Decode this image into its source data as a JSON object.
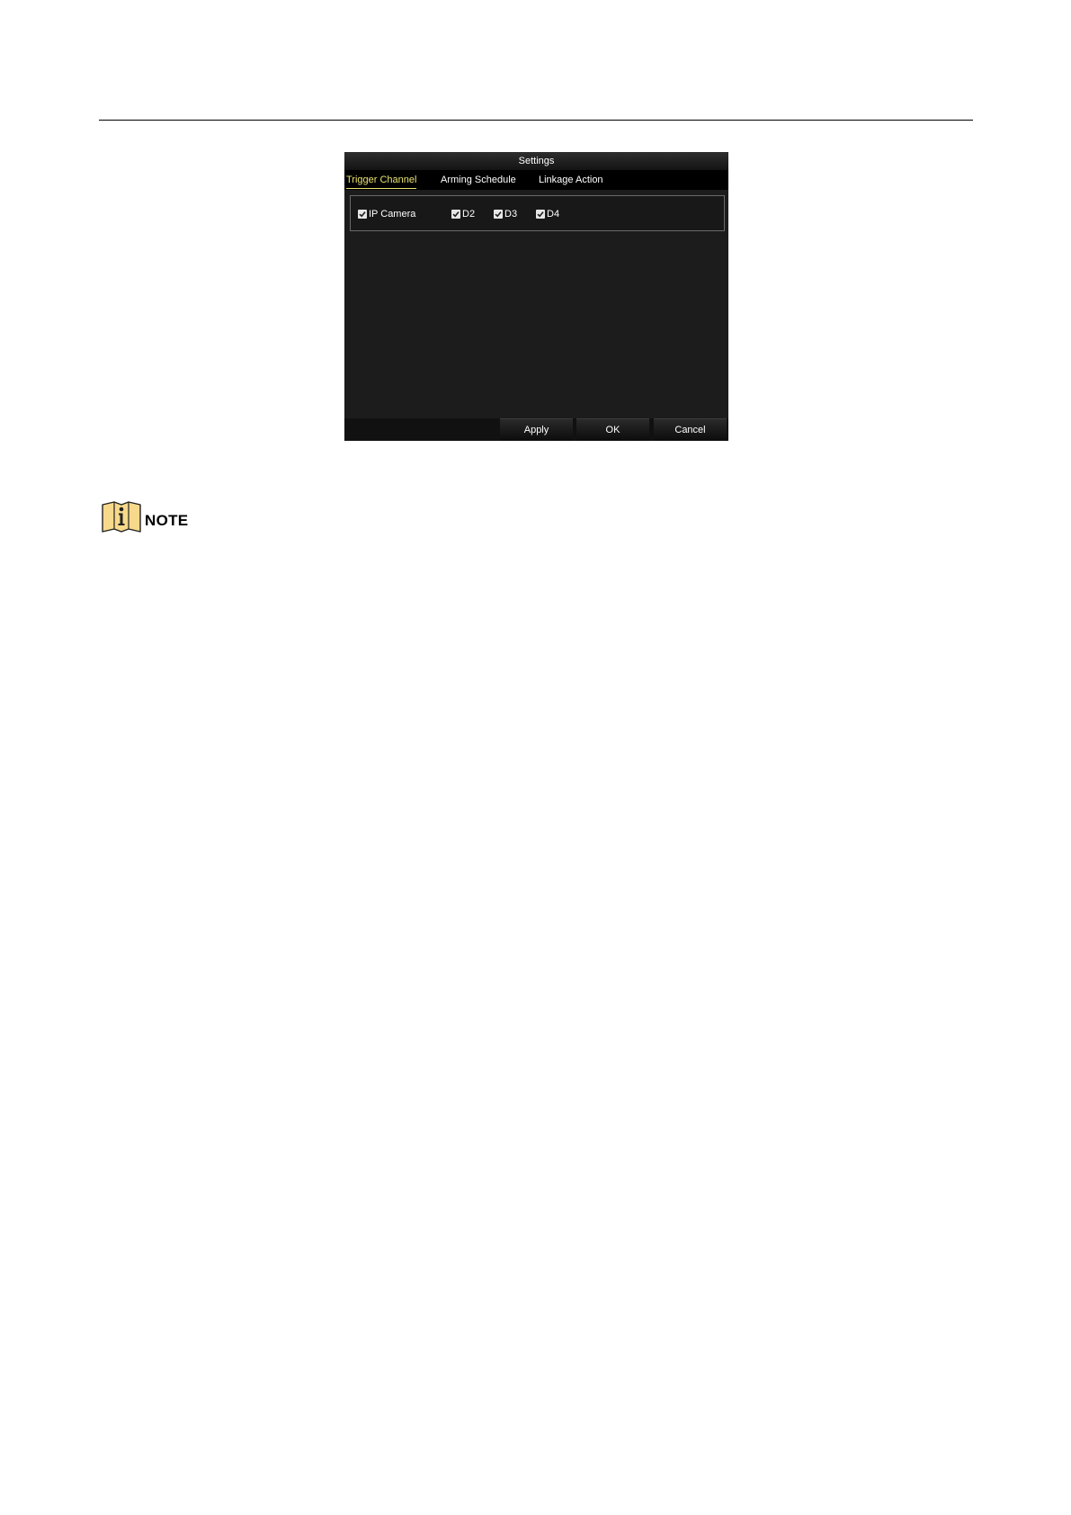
{
  "dialog": {
    "title": "Settings",
    "tabs": [
      {
        "label": "Trigger Channel",
        "active": true
      },
      {
        "label": "Arming Schedule",
        "active": false
      },
      {
        "label": "Linkage Action",
        "active": false
      }
    ],
    "channels": [
      {
        "label": "IP Camera",
        "checked": true
      },
      {
        "label": "D2",
        "checked": true
      },
      {
        "label": "D3",
        "checked": true
      },
      {
        "label": "D4",
        "checked": true
      }
    ],
    "buttons": {
      "apply": "Apply",
      "ok": "OK",
      "cancel": "Cancel"
    }
  },
  "note": {
    "label": "NOTE",
    "icon": "info-book-icon"
  },
  "colors": {
    "active_tab": "#e9e36e",
    "dialog_background": "#1c1c1c",
    "note_icon_fill": "#f7d98b"
  }
}
